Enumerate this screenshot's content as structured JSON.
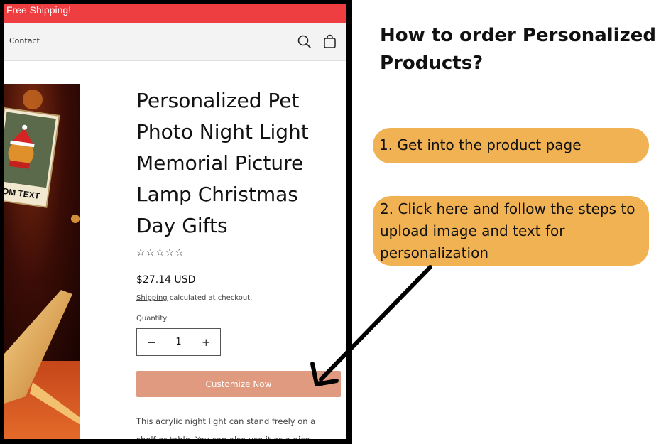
{
  "store": {
    "announcement": "Free Shipping!",
    "nav": {
      "contact_label": "Contact"
    },
    "icons": {
      "search": "search-icon",
      "cart": "cart-icon"
    }
  },
  "product": {
    "image_text": "TOM TEXT",
    "title": "Personalized Pet Photo Night Light Memorial Picture Lamp Christmas Day Gifts",
    "rating_stars": "☆☆☆☆☆",
    "price": "$27.14 USD",
    "shipping_link": "Shipping",
    "shipping_note": " calculated at checkout.",
    "quantity_label": "Quantity",
    "quantity_value": "1",
    "minus_label": "−",
    "plus_label": "+",
    "customize_label": "Customize Now",
    "description": "This acrylic night light can stand freely on a shelf or table. You can also use it as a nice"
  },
  "instructions": {
    "title": "How to order Personalized Products?",
    "step1": "1. Get into the product page",
    "step2": "2. Click here and follow the steps to upload image and text for personalization"
  },
  "colors": {
    "announcement_bg": "#ef3e42",
    "customize_bg": "#e09a7f",
    "step_bg": "#f0b253"
  }
}
